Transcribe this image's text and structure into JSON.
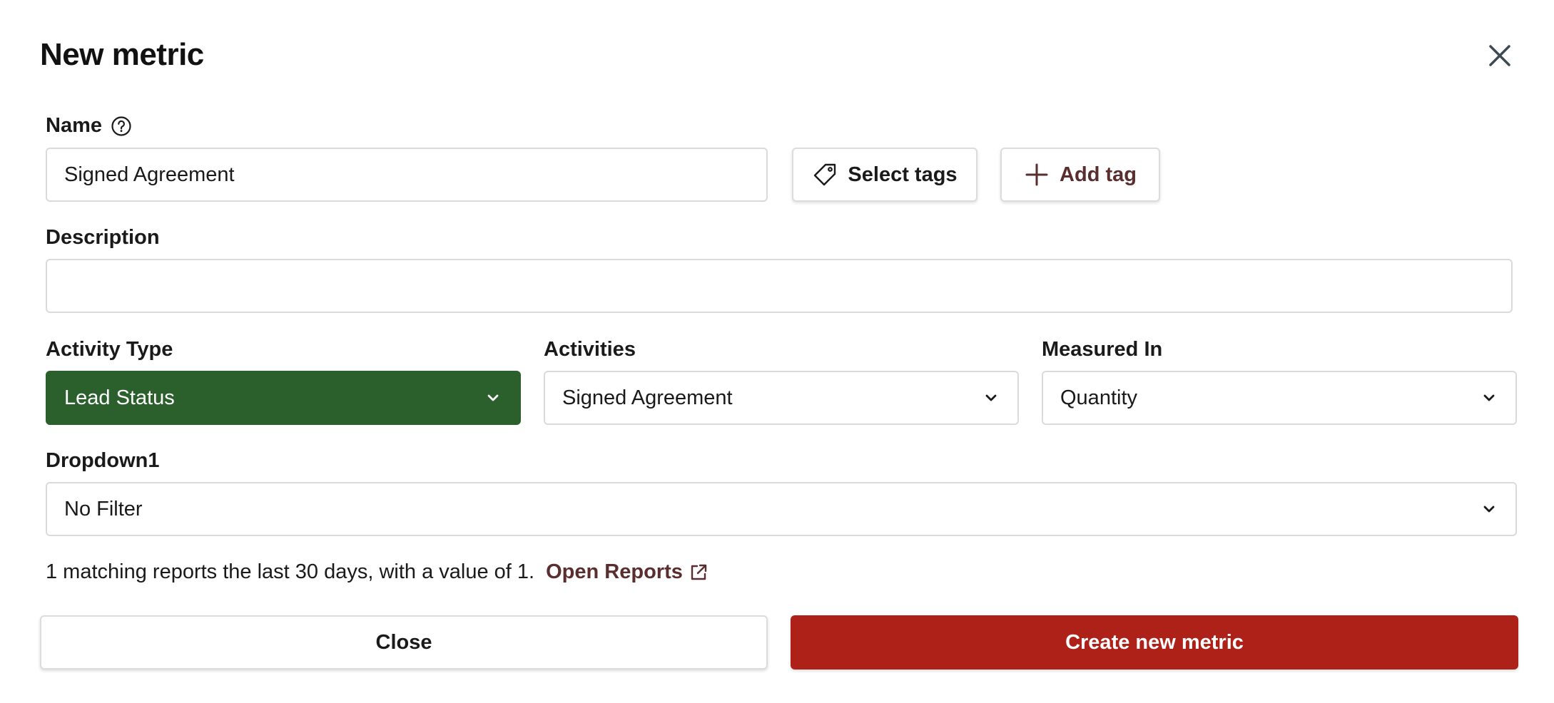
{
  "dialog": {
    "title": "New metric"
  },
  "name_field": {
    "label": "Name",
    "value": "Signed Agreement",
    "placeholder": ""
  },
  "tags": {
    "select_label": "Select tags",
    "add_label": "Add tag"
  },
  "description_field": {
    "label": "Description",
    "value": "",
    "placeholder": ""
  },
  "activity_type": {
    "label": "Activity Type",
    "value": "Lead Status"
  },
  "activities": {
    "label": "Activities",
    "value": "Signed Agreement"
  },
  "measured_in": {
    "label": "Measured In",
    "value": "Quantity"
  },
  "dropdown1": {
    "label": "Dropdown1",
    "value": "No Filter"
  },
  "info": {
    "text": "1 matching reports the last 30 days, with a value of 1.",
    "link_label": "Open Reports"
  },
  "footer": {
    "close_label": "Close",
    "create_label": "Create new metric"
  },
  "colors": {
    "activity_type_bg": "#2b602d",
    "primary_button": "#ae2119",
    "link": "#5a2e2e"
  },
  "icons": {
    "close": "close-icon",
    "help": "question-circle-icon",
    "tag": "tag-icon",
    "plus": "plus-icon",
    "chevron": "chevron-down-icon",
    "external": "external-link-icon"
  }
}
